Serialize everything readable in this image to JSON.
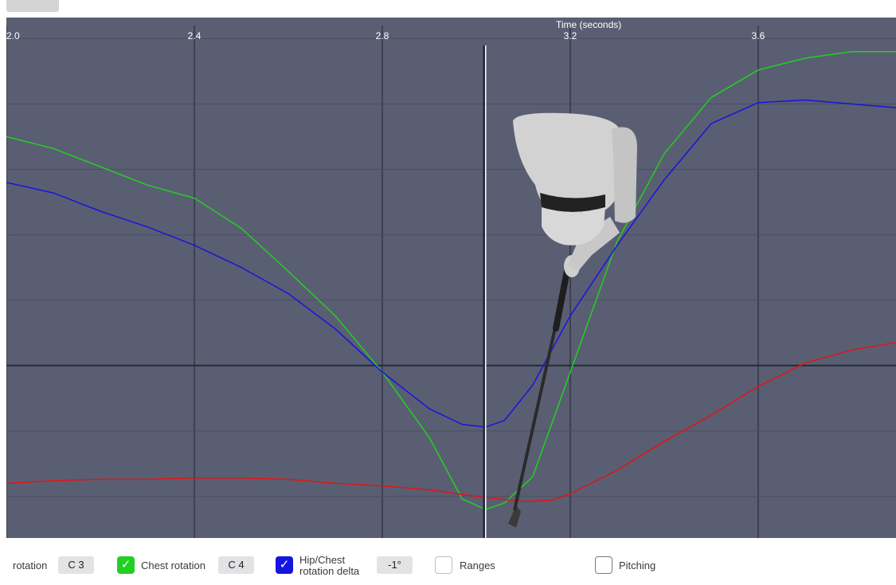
{
  "chart_data": {
    "type": "line",
    "xlabel": "Time (seconds)",
    "x_ticks": [
      "2.0",
      "2.4",
      "2.8",
      "3.2",
      "3.6"
    ],
    "xlim": [
      2.0,
      3.9
    ],
    "ylim": [
      -1.3,
      2.6
    ],
    "cursor_time": 3.02,
    "grid": true,
    "series": [
      {
        "name": "Chest rotation",
        "color": "#22d022",
        "points": [
          [
            2.0,
            1.75
          ],
          [
            2.1,
            1.66
          ],
          [
            2.2,
            1.52
          ],
          [
            2.3,
            1.38
          ],
          [
            2.4,
            1.28
          ],
          [
            2.5,
            1.05
          ],
          [
            2.6,
            0.72
          ],
          [
            2.7,
            0.38
          ],
          [
            2.8,
            -0.05
          ],
          [
            2.9,
            -0.55
          ],
          [
            2.97,
            -1.02
          ],
          [
            3.02,
            -1.1
          ],
          [
            3.06,
            -1.05
          ],
          [
            3.12,
            -0.85
          ],
          [
            3.2,
            -0.05
          ],
          [
            3.3,
            0.95
          ],
          [
            3.4,
            1.62
          ],
          [
            3.5,
            2.05
          ],
          [
            3.6,
            2.26
          ],
          [
            3.7,
            2.35
          ],
          [
            3.8,
            2.4
          ],
          [
            3.9,
            2.4
          ]
        ]
      },
      {
        "name": "Hip/Chest rotation delta",
        "color": "#1515e0",
        "points": [
          [
            2.0,
            1.4
          ],
          [
            2.1,
            1.32
          ],
          [
            2.2,
            1.18
          ],
          [
            2.3,
            1.06
          ],
          [
            2.4,
            0.92
          ],
          [
            2.5,
            0.75
          ],
          [
            2.6,
            0.55
          ],
          [
            2.7,
            0.28
          ],
          [
            2.8,
            -0.05
          ],
          [
            2.9,
            -0.33
          ],
          [
            2.97,
            -0.45
          ],
          [
            3.02,
            -0.47
          ],
          [
            3.06,
            -0.42
          ],
          [
            3.12,
            -0.15
          ],
          [
            3.2,
            0.38
          ],
          [
            3.3,
            0.92
          ],
          [
            3.4,
            1.42
          ],
          [
            3.5,
            1.85
          ],
          [
            3.6,
            2.01
          ],
          [
            3.7,
            2.03
          ],
          [
            3.8,
            2.0
          ],
          [
            3.9,
            1.97
          ]
        ]
      },
      {
        "name": "",
        "color": "#e01515",
        "points": [
          [
            2.0,
            -0.9
          ],
          [
            2.1,
            -0.88
          ],
          [
            2.2,
            -0.87
          ],
          [
            2.3,
            -0.87
          ],
          [
            2.4,
            -0.86
          ],
          [
            2.5,
            -0.86
          ],
          [
            2.6,
            -0.87
          ],
          [
            2.7,
            -0.9
          ],
          [
            2.8,
            -0.92
          ],
          [
            2.9,
            -0.95
          ],
          [
            3.0,
            -1.0
          ],
          [
            3.1,
            -1.04
          ],
          [
            3.16,
            -1.03
          ],
          [
            3.2,
            -0.98
          ],
          [
            3.3,
            -0.8
          ],
          [
            3.4,
            -0.58
          ],
          [
            3.5,
            -0.38
          ],
          [
            3.6,
            -0.16
          ],
          [
            3.7,
            0.02
          ],
          [
            3.8,
            0.12
          ],
          [
            3.9,
            0.18
          ]
        ]
      }
    ]
  },
  "legend": {
    "rotation_label": "rotation",
    "c3_value": "C 3",
    "chest_label": "Chest rotation",
    "c4_value": "C 4",
    "delta_label_line1": "Hip/Chest",
    "delta_label_line2": "rotation delta",
    "delta_value": "-1°",
    "ranges_label": "Ranges",
    "pitching_label": "Pitching",
    "check_glyph": "✓",
    "chest_checked": true,
    "delta_checked": true,
    "ranges_checked": false,
    "pitching_checked": false
  },
  "colors": {
    "chart_background": "#5a5e72",
    "chest_check": "#22d022",
    "delta_check": "#1515e0"
  },
  "icons": [
    "golfer-3d-model",
    "check-icon"
  ]
}
